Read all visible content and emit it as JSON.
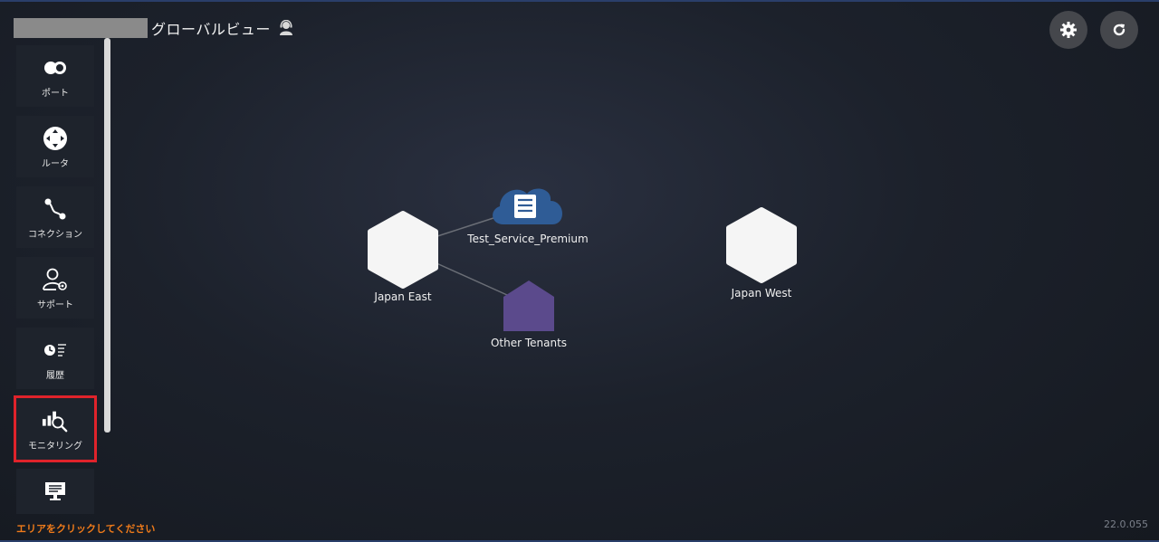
{
  "header": {
    "title": "グローバルビュー",
    "user_icon": "support-user-icon"
  },
  "sidebar": {
    "items": [
      {
        "label": "ポート",
        "icon": "port-icon"
      },
      {
        "label": "ルータ",
        "icon": "router-icon"
      },
      {
        "label": "コネクション",
        "icon": "connection-icon"
      },
      {
        "label": "サポート",
        "icon": "support-icon"
      },
      {
        "label": "履歴",
        "icon": "history-icon"
      },
      {
        "label": "モニタリング",
        "icon": "monitoring-icon"
      },
      {
        "label": "",
        "icon": "display-icon"
      }
    ]
  },
  "toolbar": {
    "settings_icon": "gear-icon",
    "refresh_icon": "refresh-icon"
  },
  "map": {
    "nodes": [
      {
        "label": "Japan East",
        "kind": "region"
      },
      {
        "label": "Test_Service_Premium",
        "kind": "cloud-service"
      },
      {
        "label": "Other Tenants",
        "kind": "tenant"
      },
      {
        "label": "Japan West",
        "kind": "region"
      }
    ]
  },
  "footer": {
    "hint": "エリアをクリックしてください",
    "version": "22.0.055"
  },
  "colors": {
    "highlight": "#e0232b",
    "hint": "#f07b1a",
    "cloud": "#2f5c96",
    "tenant": "#5b4a8c"
  }
}
